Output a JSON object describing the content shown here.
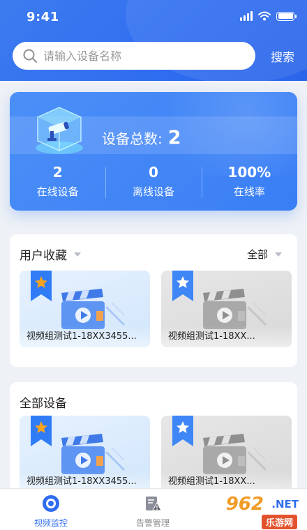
{
  "status_bar": {
    "time": "9:41"
  },
  "search": {
    "placeholder": "请输入设备名称",
    "button_label": "搜索"
  },
  "stats": {
    "total_label": "设备总数:",
    "total_value": "2",
    "items": [
      {
        "value": "2",
        "label": "在线设备"
      },
      {
        "value": "0",
        "label": "离线设备"
      },
      {
        "value": "100%",
        "label": "在线率"
      }
    ]
  },
  "favorites": {
    "title": "用户收藏",
    "filter_label": "全部",
    "devices": [
      {
        "name": "视频组测试1-18XX3455...",
        "status": "online"
      },
      {
        "name": "视频组测试1-18XX...",
        "status": "offline"
      }
    ]
  },
  "all_devices": {
    "title": "全部设备",
    "devices": [
      {
        "name": "视频组测试1-18XX3455...",
        "status": "online"
      },
      {
        "name": "视频组测试1-18XX...",
        "status": "offline"
      }
    ]
  },
  "bottom_nav": {
    "items": [
      {
        "label": "视频监控",
        "icon": "camera-lens-icon",
        "active": true
      },
      {
        "label": "告警管理",
        "icon": "alarm-doc-icon",
        "active": false
      }
    ]
  },
  "watermark": {
    "big": "962",
    "net": ".NET",
    "sub": "乐游网"
  },
  "colors": {
    "primary": "#2f6df0",
    "star_badge": "#f7a320",
    "ribbon_online": "#2f7cf6",
    "ribbon_offline": "#3f86f7"
  }
}
